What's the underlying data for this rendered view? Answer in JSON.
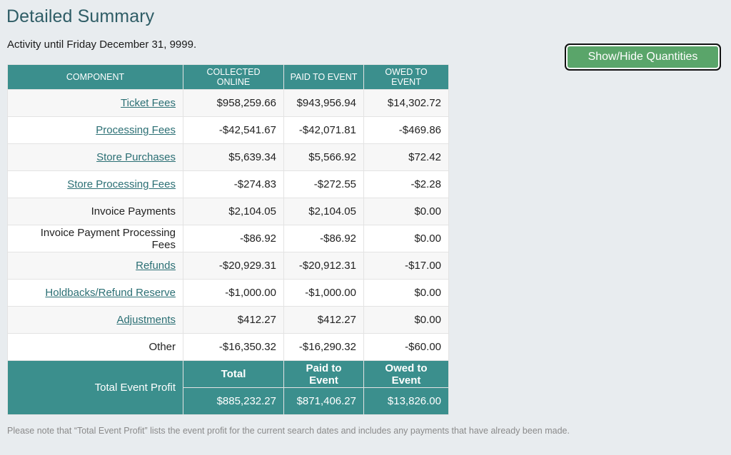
{
  "page": {
    "title": "Detailed Summary",
    "activity": "Activity until Friday December 31, 9999.",
    "toggle_button": "Show/Hide Quantities",
    "footnote": "Please note that “Total Event Profit” lists the event profit for the current search dates and includes any payments that have already been made."
  },
  "table": {
    "headers": [
      "COMPONENT",
      "COLLECTED ONLINE",
      "PAID TO EVENT",
      "OWED TO EVENT"
    ],
    "rows": [
      {
        "component": "Ticket Fees",
        "link": true,
        "collected": "$958,259.66",
        "paid": "$943,956.94",
        "owed": "$14,302.72"
      },
      {
        "component": "Processing Fees",
        "link": true,
        "collected": "-$42,541.67",
        "paid": "-$42,071.81",
        "owed": "-$469.86"
      },
      {
        "component": "Store Purchases",
        "link": true,
        "collected": "$5,639.34",
        "paid": "$5,566.92",
        "owed": "$72.42"
      },
      {
        "component": "Store Processing Fees",
        "link": true,
        "collected": "-$274.83",
        "paid": "-$272.55",
        "owed": "-$2.28"
      },
      {
        "component": "Invoice Payments",
        "link": false,
        "collected": "$2,104.05",
        "paid": "$2,104.05",
        "owed": "$0.00"
      },
      {
        "component": "Invoice Payment Processing Fees",
        "link": false,
        "collected": "-$86.92",
        "paid": "-$86.92",
        "owed": "$0.00"
      },
      {
        "component": "Refunds",
        "link": true,
        "collected": "-$20,929.31",
        "paid": "-$20,912.31",
        "owed": "-$17.00"
      },
      {
        "component": "Holdbacks/Refund Reserve",
        "link": true,
        "collected": "-$1,000.00",
        "paid": "-$1,000.00",
        "owed": "$0.00"
      },
      {
        "component": "Adjustments",
        "link": true,
        "collected": "$412.27",
        "paid": "$412.27",
        "owed": "$0.00"
      },
      {
        "component": "Other",
        "link": false,
        "collected": "-$16,350.32",
        "paid": "-$16,290.32",
        "owed": "-$60.00"
      }
    ],
    "total": {
      "label": "Total Event Profit",
      "head_total": "Total",
      "head_paid": "Paid to Event",
      "head_owed": "Owed to Event",
      "total": "$885,232.27",
      "paid": "$871,406.27",
      "owed": "$13,826.00"
    }
  },
  "colors": {
    "header_teal": "#3b8f8d",
    "title_teal": "#2f5d66",
    "link_teal": "#2b6f74",
    "button_green": "#5aa56a",
    "page_background": "#e8ecef"
  }
}
